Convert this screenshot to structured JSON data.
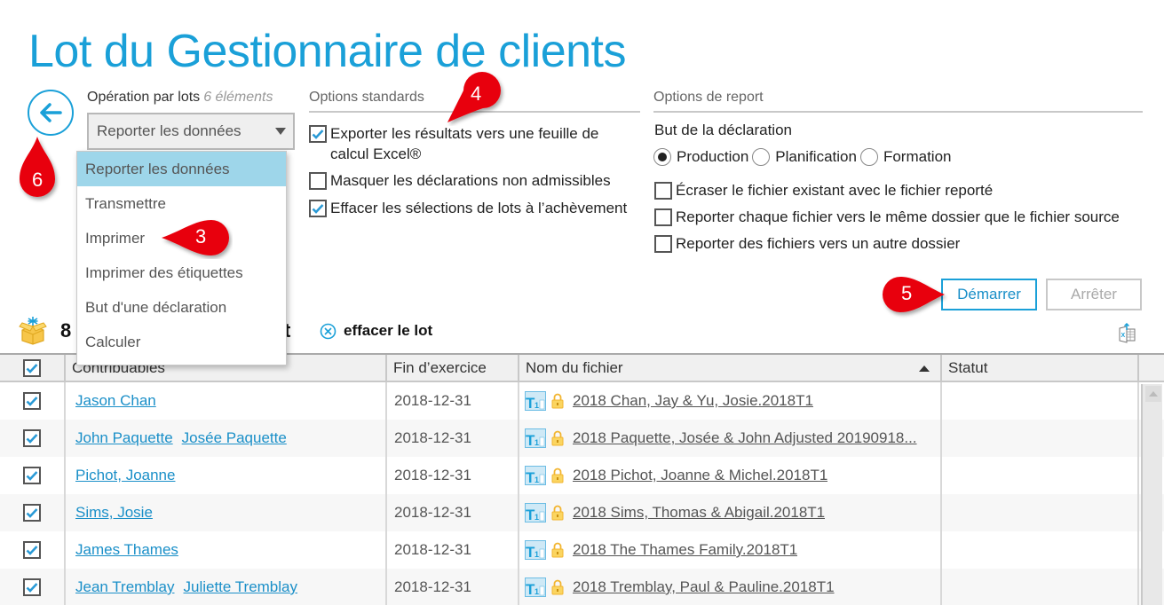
{
  "header": {
    "title": "Lot du Gestionnaire de clients"
  },
  "back_button": {
    "icon": "arrow-left-icon"
  },
  "batch_operation": {
    "label": "Opération par lots",
    "count_label": "6 éléments",
    "selected": "Reporter les données",
    "options": [
      "Reporter les données",
      "Transmettre",
      "Imprimer",
      "Imprimer des étiquettes",
      "But d'une déclaration",
      "Calculer"
    ]
  },
  "standard_options": {
    "heading": "Options standards",
    "items": [
      {
        "label_line1": "Exporter les résultats vers une feuille de",
        "label_line2": "calcul Excel®",
        "checked": true
      },
      {
        "label": "Masquer les déclarations non admissibles",
        "checked": false
      },
      {
        "label": "Effacer les sélections de lots à l’achèvement",
        "checked": true
      }
    ]
  },
  "carryforward_options": {
    "heading": "Options de report",
    "purpose_label": "But de la déclaration",
    "purpose_options": [
      {
        "label": "Production",
        "selected": true
      },
      {
        "label": "Planification",
        "selected": false
      },
      {
        "label": "Formation",
        "selected": false
      }
    ],
    "items": [
      {
        "label": "Écraser le fichier existant avec le fichier reporté",
        "checked": false
      },
      {
        "label": "Reporter chaque fichier vers le même dossier que le fichier source",
        "checked": false
      },
      {
        "label": "Reporter des fichiers vers un autre dossier",
        "checked": false
      }
    ]
  },
  "actions": {
    "start": "Démarrer",
    "stop": "Arrêter"
  },
  "batch_bar": {
    "count": "8",
    "suffix": "t",
    "clear_label": "effacer le lot"
  },
  "grid": {
    "columns": [
      "Contribuables",
      "Fin d’exercice",
      "Nom du fichier",
      "Statut"
    ],
    "sorted_column": "Nom du fichier",
    "sort_direction": "ascending",
    "rows": [
      {
        "checked": true,
        "taxpayers": [
          "Jason Chan"
        ],
        "year_end": "2018-12-31",
        "file": "2018 Chan, Jay & Yu, Josie.2018T1",
        "status": ""
      },
      {
        "checked": true,
        "taxpayers": [
          "John Paquette",
          "Josée Paquette"
        ],
        "year_end": "2018-12-31",
        "file": "2018 Paquette, Josée & John Adjusted 20190918...",
        "status": ""
      },
      {
        "checked": true,
        "taxpayers": [
          "Pichot, Joanne"
        ],
        "year_end": "2018-12-31",
        "file": "2018 Pichot, Joanne & Michel.2018T1",
        "status": ""
      },
      {
        "checked": true,
        "taxpayers": [
          "Sims, Josie"
        ],
        "year_end": "2018-12-31",
        "file": "2018 Sims, Thomas & Abigail.2018T1",
        "status": ""
      },
      {
        "checked": true,
        "taxpayers": [
          "James Thames"
        ],
        "year_end": "2018-12-31",
        "file": "2018 The Thames Family.2018T1",
        "status": ""
      },
      {
        "checked": true,
        "taxpayers": [
          "Jean Tremblay",
          "Juliette Tremblay"
        ],
        "year_end": "2018-12-31",
        "file": "2018 Tremblay, Paul & Pauline.2018T1",
        "status": ""
      }
    ]
  },
  "callouts": [
    "3",
    "4",
    "5",
    "6"
  ],
  "colors": {
    "accent": "#1aa0d8",
    "callout": "#e8000b",
    "dropdown_selected": "#9ed6ea"
  }
}
